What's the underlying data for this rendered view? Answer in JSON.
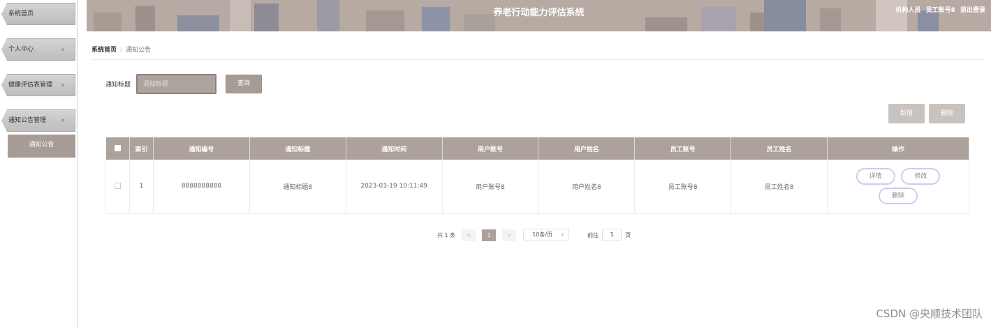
{
  "sidebar": {
    "items": [
      {
        "label": "系统首页",
        "chevron": ""
      },
      {
        "label": "个人中心",
        "chevron": "∨"
      },
      {
        "label": "健康评估表管理",
        "chevron": "∨"
      },
      {
        "label": "通知公告管理",
        "chevron": "∧"
      }
    ],
    "subitem": "通知公告"
  },
  "header": {
    "title": "养老行动能力评估系统",
    "role": "机构人员",
    "user": "员工账号8",
    "logout": "退出登录"
  },
  "breadcrumb": {
    "home": "系统首页",
    "sep": "/",
    "current": "通知公告"
  },
  "search": {
    "label": "通知标题",
    "placeholder": "通知标题",
    "button": "查询"
  },
  "actions": {
    "add": "新增",
    "delete": "删除"
  },
  "table": {
    "headers": [
      "索引",
      "通知编号",
      "通知标题",
      "通知时间",
      "用户账号",
      "用户姓名",
      "员工账号",
      "员工姓名",
      "操作"
    ],
    "rows": [
      {
        "index": "1",
        "code": "8888888888",
        "title": "通知标题8",
        "time": "2023-03-19 10:11:49",
        "user_account": "用户账号8",
        "user_name": "用户姓名8",
        "staff_account": "员工账号8",
        "staff_name": "员工姓名8",
        "ops": {
          "detail": "详情",
          "edit": "修改",
          "delete": "删除"
        }
      }
    ]
  },
  "pagination": {
    "total": "共 1 条",
    "prev": "<",
    "current_page": "1",
    "next": ">",
    "page_size": "10条/页",
    "goto": "前往",
    "goto_value": "1",
    "page_unit": "页"
  },
  "watermark": "CSDN @央顺技术团队",
  "colors": {
    "accent": "#aca19b",
    "header_bg": "#b7aaa3",
    "button": "#a79b95"
  }
}
